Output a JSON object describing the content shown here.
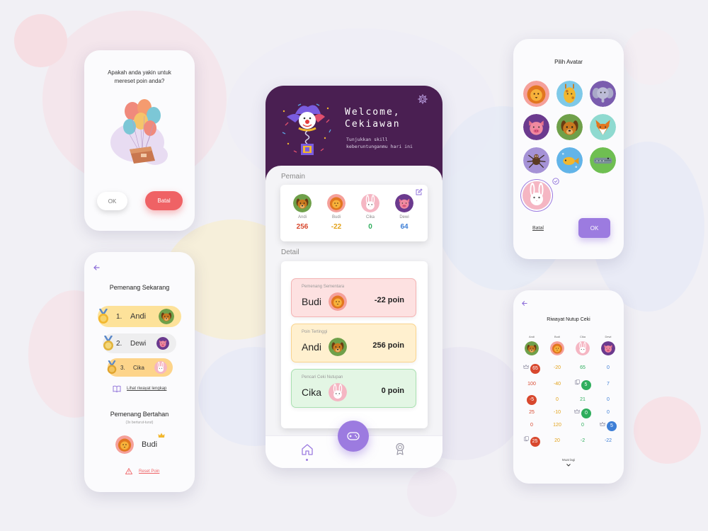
{
  "reset_dialog": {
    "question": "Apakah anda yakin untuk mereset poin anda?",
    "ok_label": "OK",
    "cancel_label": "Batal"
  },
  "winner_screen": {
    "current_winner_title": "Pemenang Sekarang",
    "ranks": [
      {
        "position": "1.",
        "name": "Andi",
        "color": "#fde29a"
      },
      {
        "position": "2.",
        "name": "Dewi",
        "color": "#eeeeef"
      },
      {
        "position": "3.",
        "name": "Cika",
        "color": "#fdd48a"
      }
    ],
    "history_link": "Lihat riwayat lengkap",
    "survivor_title": "Pemenang Bertahan",
    "survivor_subtitle": "(3x berturut-turut)",
    "survivor_name": "Budi",
    "reset_link": "Reset Poin"
  },
  "main_screen": {
    "welcome_title": "Welcome,",
    "welcome_name": "Cekiawan",
    "tagline_line1": "Tunjukkan skill",
    "tagline_line2": "keberuntunganmu hari ini",
    "players_heading": "Pemain",
    "players": [
      {
        "name": "Andi",
        "score": "256",
        "color": "#d8482e",
        "avatar": "dog"
      },
      {
        "name": "Budi",
        "score": "-22",
        "color": "#e3a21a",
        "avatar": "lion"
      },
      {
        "name": "Cika",
        "score": "0",
        "color": "#2fae5d",
        "avatar": "rabbit"
      },
      {
        "name": "Dewi",
        "score": "64",
        "color": "#3e7fd6",
        "avatar": "pig"
      }
    ],
    "detail_heading": "Detail",
    "details": [
      {
        "label": "Pemenang Sementara",
        "name": "Budi",
        "points": "-22 poin",
        "bg": "#fde1e1",
        "border": "#f3b3b3",
        "avatar": "lion"
      },
      {
        "label": "Poin Tertinggi",
        "name": "Andi",
        "points": "256 poin",
        "bg": "#fff0cf",
        "border": "#fad48e",
        "avatar": "dog"
      },
      {
        "label": "Pencari Ceki Nutupan",
        "name": "Cika",
        "points": "0 poin",
        "bg": "#e3f6e4",
        "border": "#a9e0b0",
        "avatar": "rabbit"
      }
    ]
  },
  "avatar_picker": {
    "title": "Pilih Avatar",
    "avatars": [
      "lion",
      "giraffe",
      "elephant",
      "pig",
      "dog",
      "fox",
      "spider",
      "fish",
      "crocodile",
      "rabbit"
    ],
    "selected": "rabbit",
    "cancel_label": "Batal",
    "ok_label": "OK"
  },
  "history_screen": {
    "title": "Riwayat Nutup Ceki",
    "players": [
      {
        "name": "Andi",
        "avatar": "dog"
      },
      {
        "name": "Budi",
        "avatar": "lion"
      },
      {
        "name": "Cika",
        "avatar": "rabbit"
      },
      {
        "name": "Dewi",
        "avatar": "pig"
      }
    ],
    "rows": [
      [
        {
          "v": "65",
          "badge": "#d8482e",
          "icon": "crown"
        },
        {
          "v": "-20",
          "color": "#e3a21a"
        },
        {
          "v": "65",
          "color": "#2fae5d"
        },
        {
          "v": "0",
          "color": "#3e7fd6"
        }
      ],
      [
        {
          "v": "100",
          "color": "#d8482e"
        },
        {
          "v": "-40",
          "color": "#e3a21a"
        },
        {
          "v": "5",
          "badge": "#2fae5d",
          "icon": "cards"
        },
        {
          "v": "7",
          "color": "#3e7fd6"
        }
      ],
      [
        {
          "v": "-5",
          "badge": "#d8482e"
        },
        {
          "v": "0",
          "color": "#e3a21a"
        },
        {
          "v": "21",
          "color": "#2fae5d"
        },
        {
          "v": "0",
          "color": "#3e7fd6"
        }
      ],
      [
        {
          "v": "25",
          "color": "#d8482e"
        },
        {
          "v": "-10",
          "color": "#e3a21a"
        },
        {
          "v": "0",
          "badge": "#2fae5d",
          "icon": "crown"
        },
        {
          "v": "0",
          "color": "#3e7fd6"
        }
      ],
      [
        {
          "v": "0",
          "color": "#d8482e"
        },
        {
          "v": "120",
          "color": "#e3a21a"
        },
        {
          "v": "0",
          "color": "#2fae5d"
        },
        {
          "v": "5",
          "badge": "#3e7fd6",
          "icon": "crown"
        }
      ],
      [
        {
          "v": "25",
          "badge": "#d8482e",
          "icon": "cards"
        },
        {
          "v": "20",
          "color": "#e3a21a"
        },
        {
          "v": "-2",
          "color": "#2fae5d"
        },
        {
          "v": "-22",
          "color": "#3e7fd6"
        }
      ]
    ],
    "more_label": "Muat lagi"
  },
  "theme": {
    "purple_header": "#4a1f52",
    "accent_purple": "#9c7be0",
    "danger": "#ef6265"
  }
}
